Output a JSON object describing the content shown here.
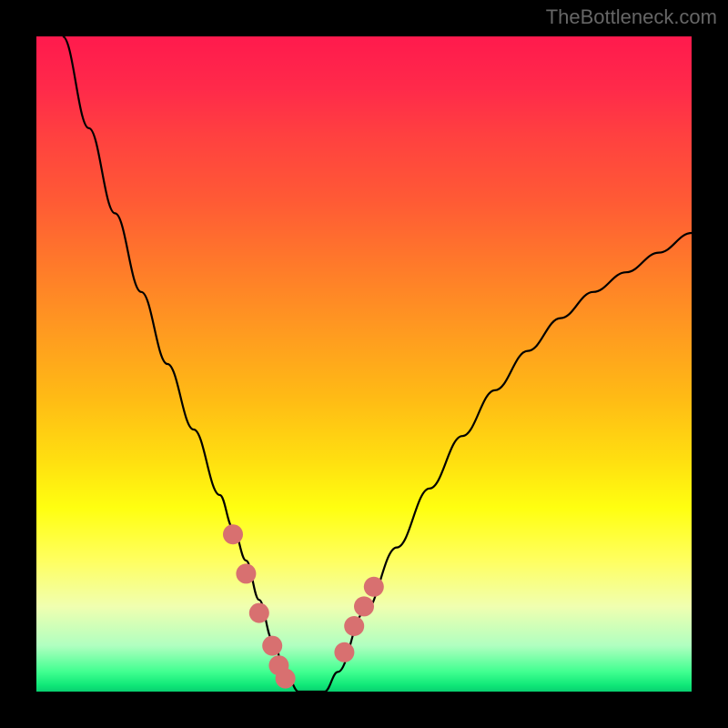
{
  "watermark": "TheBottleneck.com",
  "chart_data": {
    "type": "line",
    "title": "",
    "xlabel": "",
    "ylabel": "",
    "xlim": [
      0,
      100
    ],
    "ylim": [
      0,
      100
    ],
    "series": [
      {
        "name": "bottleneck-curve",
        "x": [
          4,
          8,
          12,
          16,
          20,
          24,
          28,
          30,
          32,
          34,
          36,
          38,
          40,
          42,
          44,
          46,
          50,
          55,
          60,
          65,
          70,
          75,
          80,
          85,
          90,
          95,
          100
        ],
        "y": [
          100,
          86,
          73,
          61,
          50,
          40,
          30,
          25,
          20,
          14,
          8,
          3,
          0,
          0,
          0,
          3,
          12,
          22,
          31,
          39,
          46,
          52,
          57,
          61,
          64,
          67,
          70
        ]
      },
      {
        "name": "highlight-dots-left",
        "x": [
          30,
          32,
          34,
          36,
          37,
          38
        ],
        "y": [
          24,
          18,
          12,
          7,
          4,
          2
        ]
      },
      {
        "name": "highlight-dots-right",
        "x": [
          47,
          48.5,
          50,
          51.5
        ],
        "y": [
          6,
          10,
          13,
          16
        ]
      }
    ],
    "colors": {
      "curve": "#000000",
      "dots": "#d87070",
      "gradient_top": "#ff1a4d",
      "gradient_bottom": "#10e878"
    }
  }
}
